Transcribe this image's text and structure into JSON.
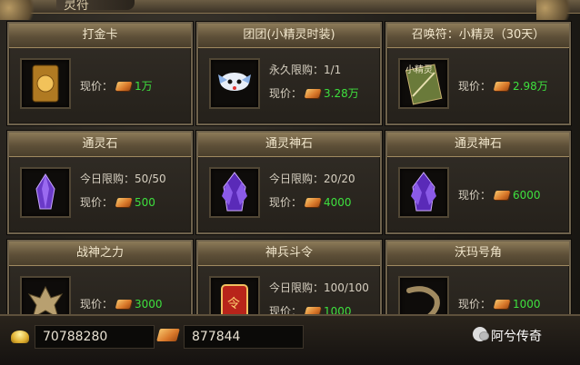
{
  "header": {
    "tab_title": "灵符"
  },
  "items": [
    {
      "name": "打金卡",
      "limit": "",
      "price_label": "现价：",
      "price": "1万",
      "icon": "gold-card-icon"
    },
    {
      "name": "团团(小精灵时装)",
      "limit": "永久限购：1/1",
      "price_label": "现价：",
      "price": "3.28万",
      "icon": "fairy-outfit-icon"
    },
    {
      "name": "召唤符：小精灵（30天）",
      "limit": "",
      "price_label": "现价：",
      "price": "2.98万",
      "icon": "summon-scroll-icon",
      "icon_text": "小精灵"
    },
    {
      "name": "通灵石",
      "limit": "今日限购：50/50",
      "price_label": "现价：",
      "price": "500",
      "icon": "spirit-stone-icon"
    },
    {
      "name": "通灵神石",
      "limit": "今日限购：20/20",
      "price_label": "现价：",
      "price": "4000",
      "icon": "divine-stone-icon"
    },
    {
      "name": "通灵神石",
      "limit": "",
      "price_label": "现价：",
      "price": "6000",
      "icon": "divine-stone-icon"
    },
    {
      "name": "战神之力",
      "limit": "",
      "price_label": "现价：",
      "price": "3000",
      "icon": "war-god-power-icon"
    },
    {
      "name": "神兵斗令",
      "limit": "今日限购：100/100",
      "price_label": "现价：",
      "price": "1000",
      "icon": "battle-token-icon",
      "icon_text": "令"
    },
    {
      "name": "沃玛号角",
      "limit": "",
      "price_label": "现价：",
      "price": "1000",
      "icon": "woma-horn-icon"
    }
  ],
  "footer": {
    "ingot_amount": "70788280",
    "gold_amount": "877844"
  },
  "watermark": {
    "text": "阿兮传奇"
  },
  "colors": {
    "price": "#3ee03e",
    "title_bar": "#6e5e42",
    "card_border": "#6e624c"
  }
}
